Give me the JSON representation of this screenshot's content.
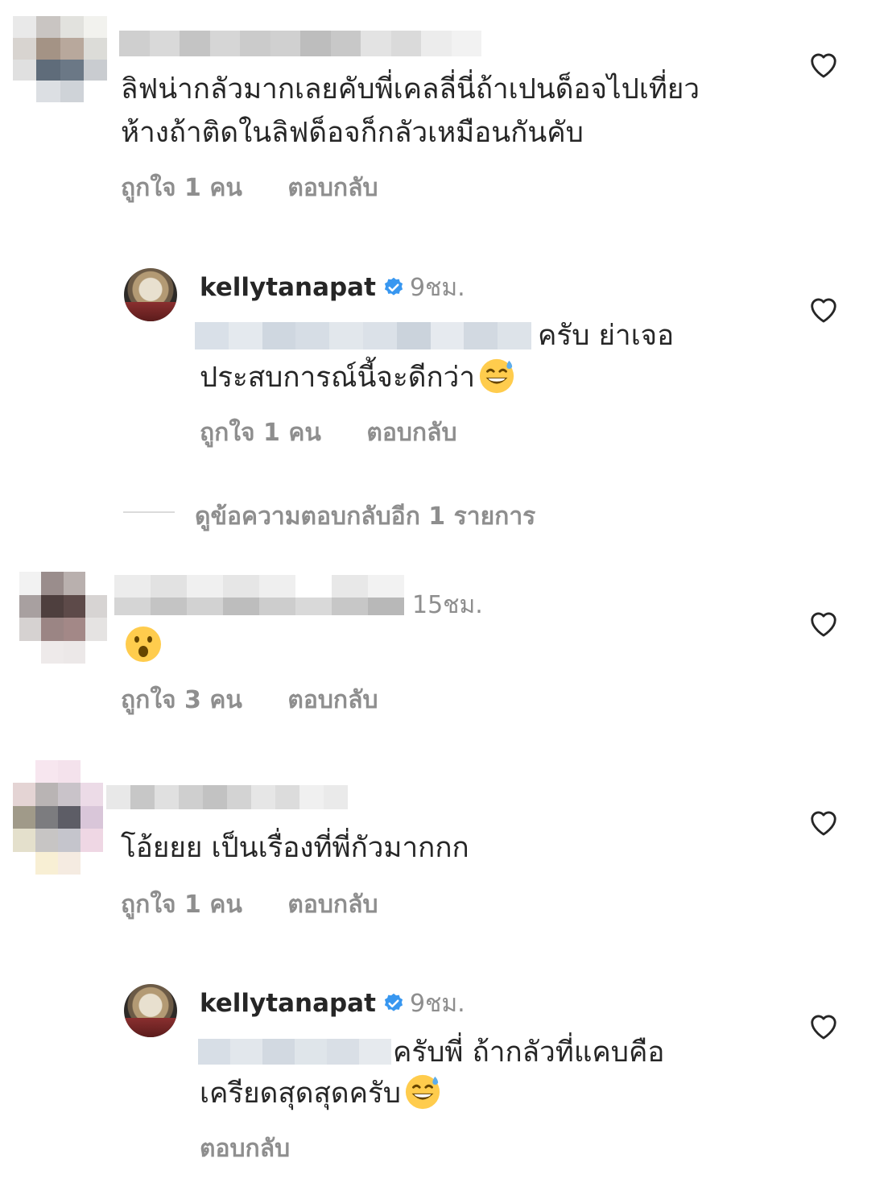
{
  "colors": {
    "text": "#262626",
    "secondary": "#8e8e8e",
    "verified": "#3897f0",
    "divider": "#dbdbdb"
  },
  "icons": {
    "like": "heart-outline-icon",
    "verified": "verified-badge-icon",
    "emoji_sweat": "grinning-sweat-emoji",
    "emoji_surprised": "surprised-face-emoji"
  },
  "comments": [
    {
      "username_hidden": true,
      "text_line1": "ลิฟน่ากลัวมากเลยคับพี่เคลลี่นี่ถ้าเปนด็อจไปเที่ยว",
      "text_line2": "ห้างถ้าติดในลิฟด็อจก็กลัวเหมือนกันคับ",
      "likes": "ถูกใจ 1 คน",
      "reply": "ตอบกลับ"
    },
    {
      "username": "kellytanapat",
      "time": "9ชม.",
      "text_line1": "ครับ ย่าเจอ",
      "text_line2": "ประสบการณ์นี้จะดีกว่า",
      "likes": "ถูกใจ 1 คน",
      "reply": "ตอบกลับ"
    },
    {
      "view_replies": "ดูข้อความตอบกลับอีก 1 รายการ"
    },
    {
      "time": "15ชม.",
      "likes": "ถูกใจ 3 คน",
      "reply": "ตอบกลับ"
    },
    {
      "text_line1": "โอ้ยยย เป็นเรื่องที่พี่กัวมากกก",
      "likes": "ถูกใจ 1 คน",
      "reply": "ตอบกลับ"
    },
    {
      "username": "kellytanapat",
      "time": "9ชม.",
      "text_line1": "ครับพี่ ถ้ากลัวที่แคบคือ",
      "text_line2": "เครียดสุดสุดครับ",
      "reply": "ตอบกลับ"
    }
  ]
}
